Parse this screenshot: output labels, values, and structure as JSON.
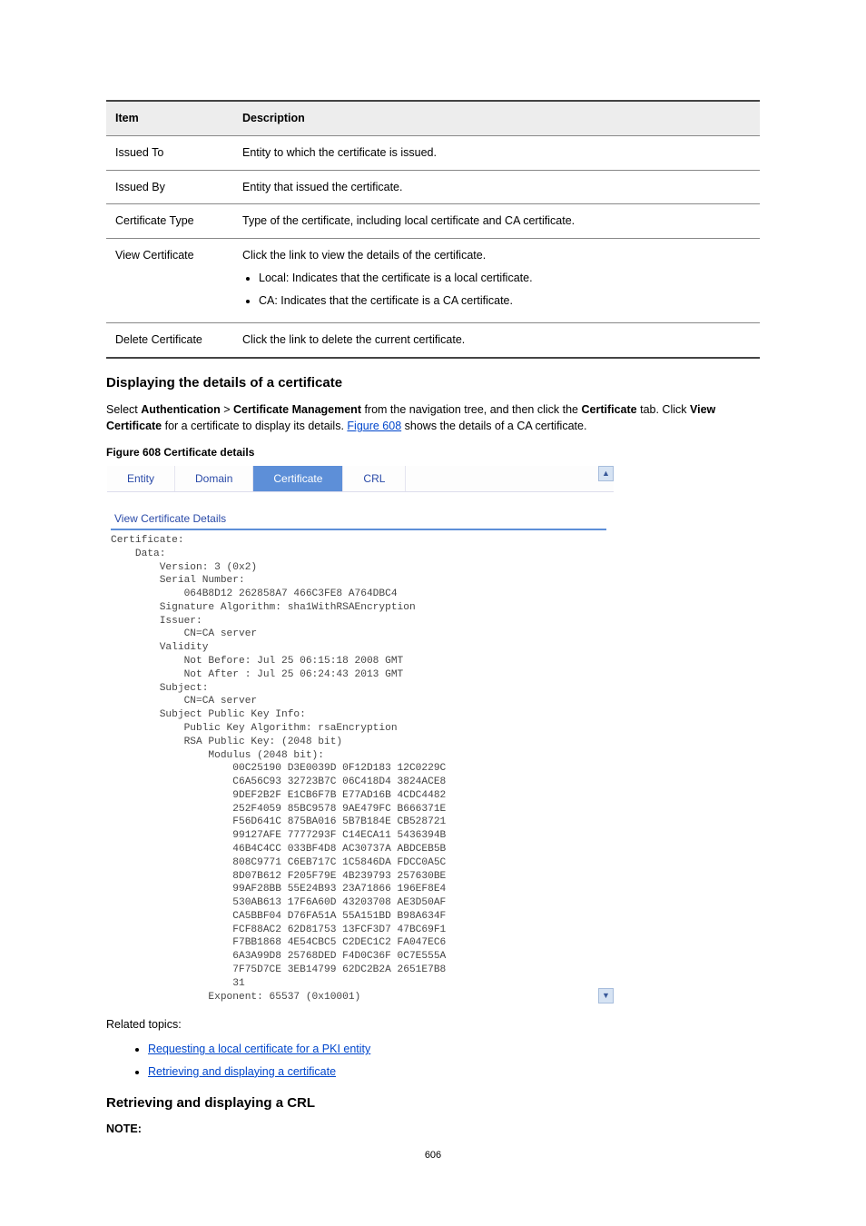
{
  "page_number": "606",
  "param_table": {
    "headers": [
      "Item",
      "Description"
    ],
    "rows": [
      {
        "item": "Issued To",
        "desc": "Entity to which the certificate is issued."
      },
      {
        "item": "Issued By",
        "desc": "Entity that issued the certificate."
      },
      {
        "item": "Certificate Type",
        "desc": "Type of the certificate, including local certificate and CA certificate."
      },
      {
        "item": "View Certificate",
        "desc_intro": "Click the link to view the details of the certificate.",
        "bullets": [
          "Local: Indicates that the certificate is a local certificate.",
          "CA: Indicates that the certificate is a CA certificate."
        ]
      },
      {
        "item": "Delete Certificate",
        "desc": "Click the link to delete the current certificate."
      }
    ]
  },
  "view_section": {
    "heading": "Displaying the details of a certificate",
    "intro_1": "Select ",
    "intro_bold_1": "Authentication",
    "intro_mid": " > ",
    "intro_bold_2": "Certificate Management",
    "intro_2": " from the navigation tree, and then click the ",
    "intro_bold_3": "Certificate",
    "intro_3": " tab. Click ",
    "intro_bold_4": "View Certificate",
    "intro_4": " for a certificate to display its details. ",
    "xref_text": "Figure 608",
    "intro_5": " shows the details of a CA certificate."
  },
  "figure_caption_prefix": "Figure 608 ",
  "figure_caption": "Certificate details",
  "screenshot": {
    "tabs": [
      "Entity",
      "Domain",
      "Certificate",
      "CRL"
    ],
    "active_tab_index": 2,
    "panel_title": "View Certificate Details",
    "scroll_up": "▲",
    "scroll_down": "▼",
    "cert_text": "Certificate:\n    Data:\n        Version: 3 (0x2)\n        Serial Number:\n            064B8D12 262858A7 466C3FE8 A764DBC4\n        Signature Algorithm: sha1WithRSAEncryption\n        Issuer:\n            CN=CA server\n        Validity\n            Not Before: Jul 25 06:15:18 2008 GMT\n            Not After : Jul 25 06:24:43 2013 GMT\n        Subject:\n            CN=CA server\n        Subject Public Key Info:\n            Public Key Algorithm: rsaEncryption\n            RSA Public Key: (2048 bit)\n                Modulus (2048 bit):\n                    00C25190 D3E0039D 0F12D183 12C0229C\n                    C6A56C93 32723B7C 06C418D4 3824ACE8\n                    9DEF2B2F E1CB6F7B E77AD16B 4CDC4482\n                    252F4059 85BC9578 9AE479FC B666371E\n                    F56D641C 875BA016 5B7B184E CB528721\n                    99127AFE 7777293F C14ECA11 5436394B\n                    46B4C4CC 033BF4D8 AC30737A ABDCEB5B\n                    808C9771 C6EB717C 1C5846DA FDCC0A5C\n                    8D07B612 F205F79E 4B239793 257630BE\n                    99AF28BB 55E24B93 23A71866 196EF8E4\n                    530AB613 17F6A60D 43203708 AE3D50AF\n                    CA5BBF04 D76FA51A 55A151BD B98A634F\n                    FCF88AC2 62D81753 13FCF3D7 47BC69F1\n                    F7BB1868 4E54CBC5 C2DEC1C2 FA047EC6\n                    6A3A99D8 25768DED F4D0C36F 0C7E555A\n                    7F75D7CE 3EB14799 62DC2B2A 2651E7B8\n                    31\n                Exponent: 65537 (0x10001)"
  },
  "related": {
    "label": "Related topics:",
    "items": [
      "Requesting a local certificate for a PKI entity",
      "Retrieving and displaying a certificate"
    ]
  },
  "crl_section": {
    "heading": "Retrieving and displaying a CRL",
    "note_label": "NOTE:"
  }
}
